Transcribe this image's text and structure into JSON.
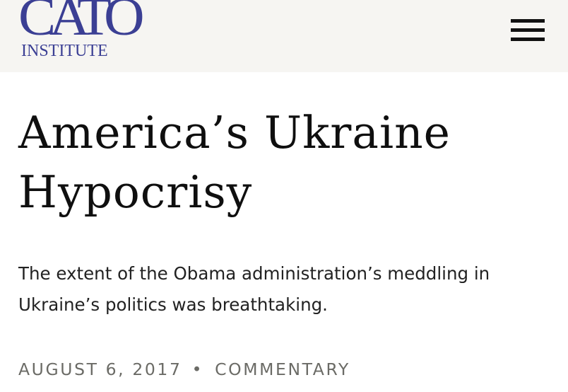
{
  "header": {
    "logo_main": "CATO",
    "logo_sub": "INSTITUTE",
    "menu_icon": "hamburger-menu-icon"
  },
  "article": {
    "title": "America’s Ukraine Hypocrisy",
    "subtitle": "The extent of the Obama administration’s meddling in Ukraine’s politics was breathtaking.",
    "date": "AUGUST 6, 2017",
    "separator": "•",
    "type": "COMMENTARY"
  },
  "colors": {
    "header_bg": "#f6f5f2",
    "logo": "#3b3f94",
    "title": "#0f0f0f",
    "subtitle": "#222222",
    "meta": "#6b6b66"
  }
}
